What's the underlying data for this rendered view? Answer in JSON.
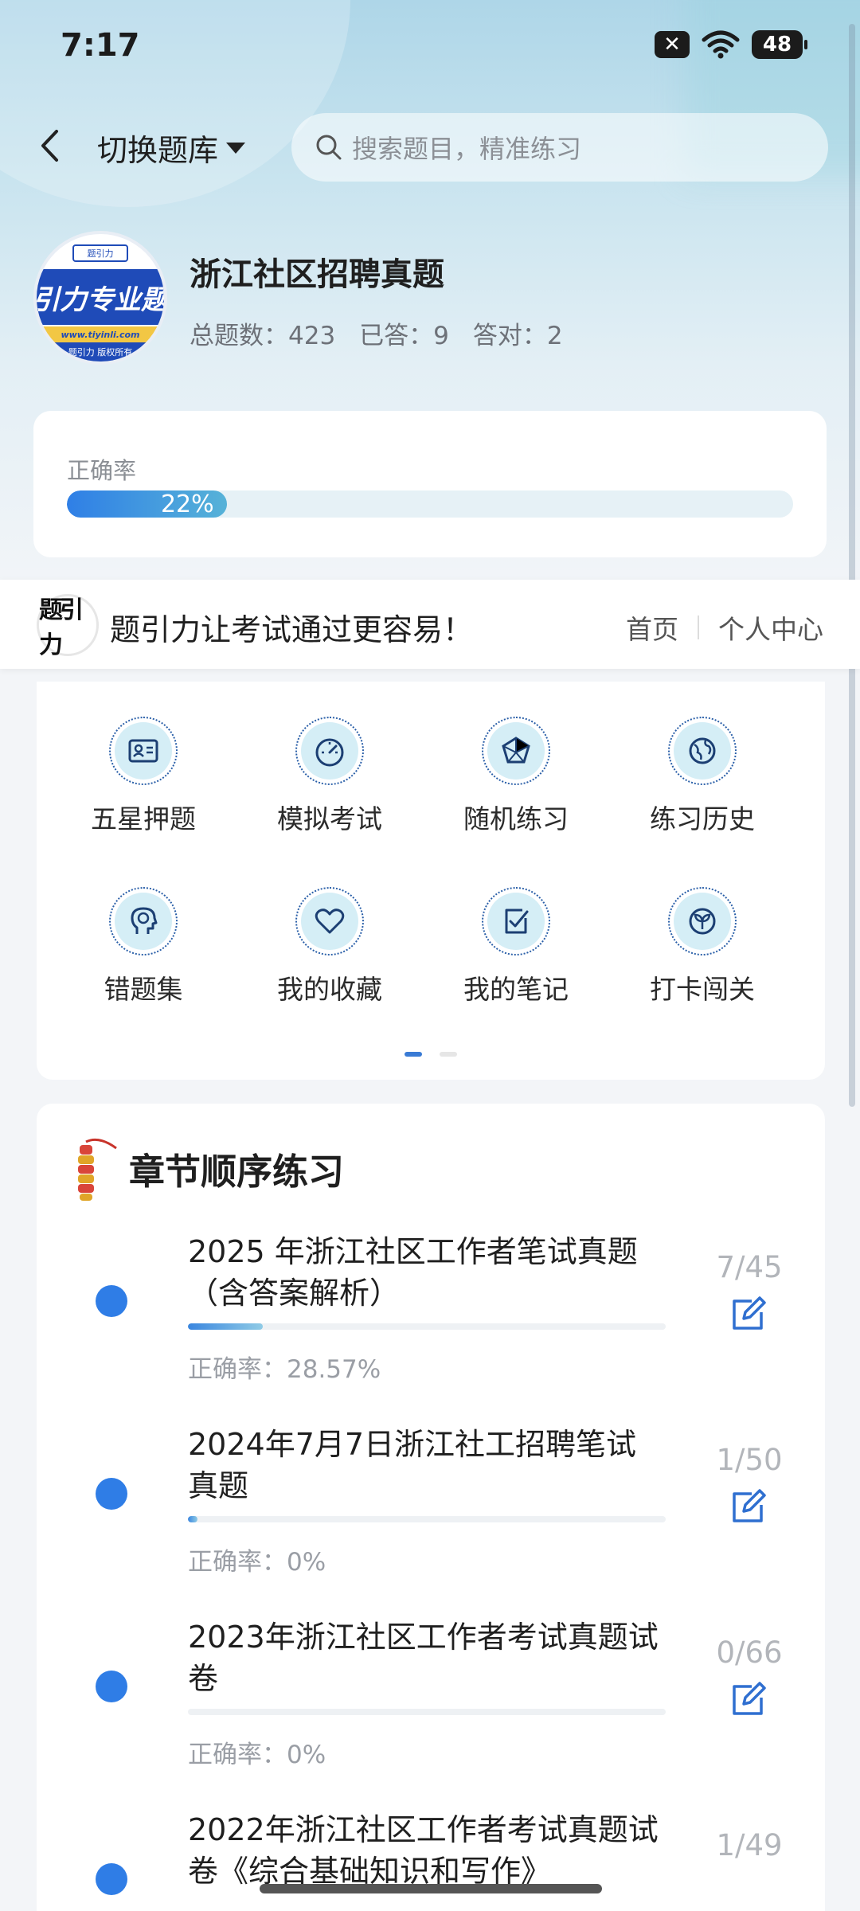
{
  "status": {
    "time": "7:17",
    "battery": "48",
    "notif": "✕"
  },
  "nav": {
    "switch_label": "切换题库",
    "search_placeholder": "搜索题目，精准练习"
  },
  "bank": {
    "logo": {
      "band_text": "引力专业题",
      "url": "www.tiyinli.com",
      "copyright": "题引力 版权所有",
      "chip": "题引力"
    },
    "title": "浙江社区招聘真题",
    "stats": [
      {
        "label": "总题数：",
        "value": "423"
      },
      {
        "label": "已答：",
        "value": "9"
      },
      {
        "label": "答对：",
        "value": "2"
      }
    ]
  },
  "accuracy": {
    "label": "正确率",
    "value_text": "22%",
    "fraction": 0.22
  },
  "promo": {
    "logo_text": "题引力",
    "text": "题引力让考试通过更容易！",
    "links": [
      "首页",
      "个人中心"
    ]
  },
  "grid": {
    "items": [
      {
        "label": "五星押题",
        "icon": "id-card-icon"
      },
      {
        "label": "模拟考试",
        "icon": "gauge-icon"
      },
      {
        "label": "随机练习",
        "icon": "random-icon"
      },
      {
        "label": "练习历史",
        "icon": "globe-icon"
      },
      {
        "label": "错题集",
        "icon": "head-icon"
      },
      {
        "label": "我的收藏",
        "icon": "heart-icon"
      },
      {
        "label": "我的笔记",
        "icon": "note-check-icon"
      },
      {
        "label": "打卡闯关",
        "icon": "sprout-icon"
      }
    ],
    "pages": 2,
    "active_page": 0
  },
  "chapters": {
    "title": "章节顺序练习",
    "items": [
      {
        "name": "2025 年浙江社区工作者笔试真题（含答案解析）",
        "accuracy": "正确率：28.57%",
        "count": "7/45",
        "progress": 0.156
      },
      {
        "name": "2024年7月7日浙江社工招聘笔试真题",
        "accuracy": "正确率：0%",
        "count": "1/50",
        "progress": 0.02
      },
      {
        "name": "2023年浙江社区工作者考试真题试卷",
        "accuracy": "正确率：0%",
        "count": "0/66",
        "progress": 0
      },
      {
        "name": "2022年浙江社区工作者考试真题试卷《综合基础知识和写作》",
        "accuracy": "",
        "count": "1/49",
        "progress": 0.02
      }
    ]
  }
}
